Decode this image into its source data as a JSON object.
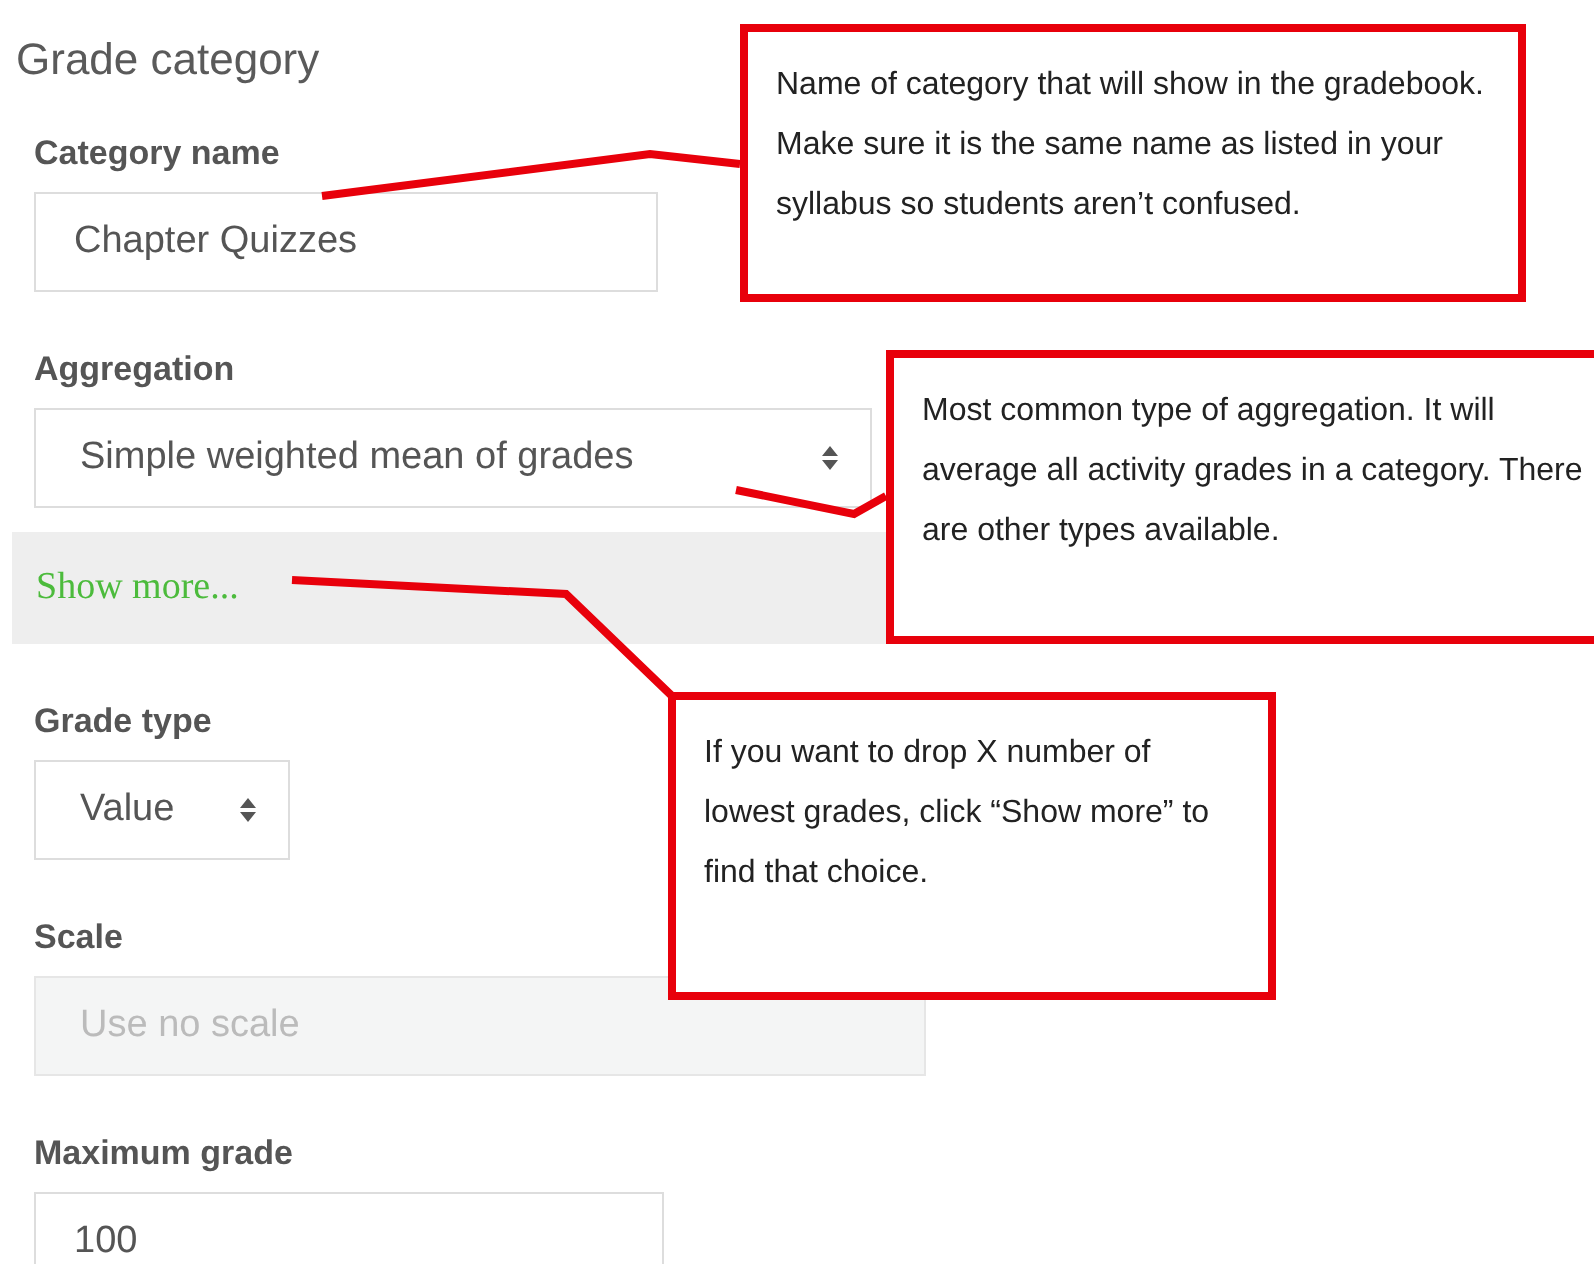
{
  "form": {
    "title": "Grade category",
    "items": [
      {
        "kind": "input",
        "label": "Category name",
        "value": "Chapter Quizzes",
        "disabled": false
      },
      {
        "kind": "select",
        "label": "Aggregation",
        "value": "Simple weighted mean of grades",
        "disabled": false
      },
      {
        "kind": "link",
        "text": "Show more..."
      },
      {
        "kind": "select",
        "label": "Grade type",
        "value": "Value",
        "disabled": false
      },
      {
        "kind": "select",
        "label": "Scale",
        "value": "Use no scale",
        "disabled": true
      },
      {
        "kind": "input",
        "label": "Maximum grade",
        "value": "100",
        "disabled": false
      }
    ]
  },
  "callouts": [
    {
      "text": "Name of category that will show in the gradebook. Make sure it is the same name as listed in your syllabus so students aren’t confused."
    },
    {
      "text": "Most common type of aggregation. It will average all activity grades in a category. There are other types available."
    },
    {
      "text": "If you want to drop X number of lowest grades, click “Show more” to find that choice."
    }
  ]
}
